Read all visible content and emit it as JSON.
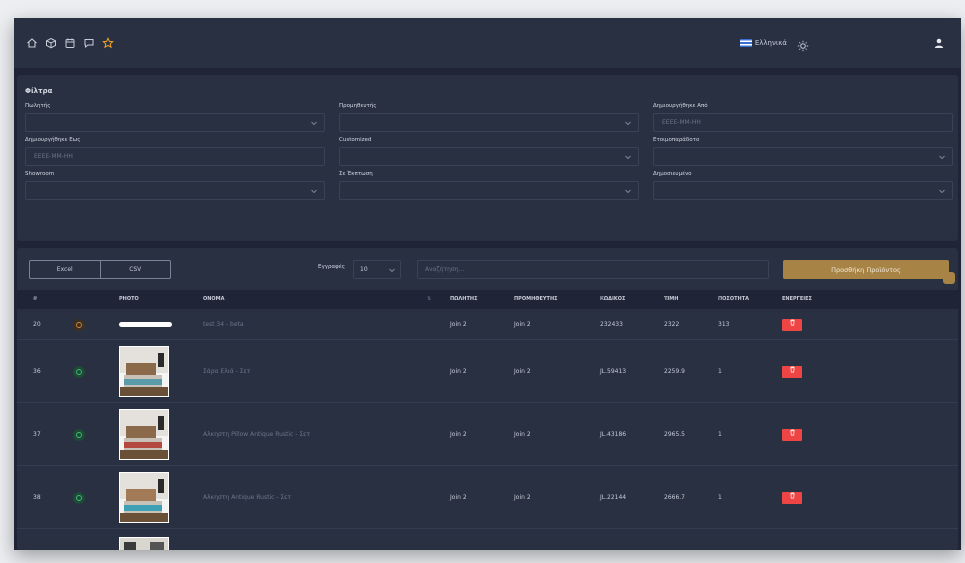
{
  "header": {
    "language": "Ελληνικά"
  },
  "filters": {
    "title": "Φίλτρα",
    "fields": [
      {
        "label": "Πωλητής",
        "value": "",
        "type": "select"
      },
      {
        "label": "Προμηθευτής",
        "value": "",
        "type": "select"
      },
      {
        "label": "Δημιουργήθηκε Από",
        "value": "",
        "placeholder": "ΕΕΕΕ-ΜΜ-ΗΗ",
        "type": "date"
      },
      {
        "label": "Δημιουργήθηκε Εως",
        "value": "",
        "placeholder": "ΕΕΕΕ-ΜΜ-ΗΗ",
        "type": "date"
      },
      {
        "label": "Customized",
        "value": "",
        "type": "select"
      },
      {
        "label": "Ετοιμοπαράδοτο",
        "value": "",
        "type": "select"
      },
      {
        "label": "Showroom",
        "value": "",
        "type": "select"
      },
      {
        "label": "Σε Έκπτωση",
        "value": "",
        "type": "select"
      },
      {
        "label": "Δημοσιευμένο",
        "value": "",
        "type": "select"
      }
    ]
  },
  "toolbar": {
    "excel_label": "Excel",
    "csv_label": "CSV",
    "records_label": "Εγγραφές",
    "records_value": "10",
    "search_placeholder": "Αναζήτηση...",
    "add_label": "Προσθήκη Προϊόντος"
  },
  "table": {
    "headers": {
      "id": "#",
      "photo": "PHOTO",
      "name": "ΟΝΟΜΑ",
      "seller": "ΠΩΛΗΤΗΣ",
      "supplier": "ΠΡΟΜΗΘΕΥΤΗΣ",
      "code": "ΚΩΔΙΚΟΣ",
      "price": "ΤΙΜΗ",
      "quantity": "ΠΟΣΟΤΗΤΑ",
      "actions": "ΕΝΕΡΓΕΙΕΣ"
    },
    "rows": [
      {
        "id": "20",
        "status": "pending",
        "photo": "bar",
        "name": "test 34 - beta",
        "seller": "Join 2",
        "supplier": "Join 2",
        "code": "232433",
        "price": "2322",
        "quantity": "313",
        "actions": 4
      },
      {
        "id": "36",
        "status": "active",
        "photo": "bed",
        "name": "Σάρα Ελιά - Σετ",
        "seller": "Join 2",
        "supplier": "Join 2",
        "code": "JL.59413",
        "price": "2259.9",
        "quantity": "1",
        "actions": 6
      },
      {
        "id": "37",
        "status": "active",
        "photo": "bed-alt",
        "name": "Αλκηστη Pillow Antique Rustic - Σετ",
        "seller": "Join 2",
        "supplier": "Join 2",
        "code": "JL.43186",
        "price": "2965.5",
        "quantity": "1",
        "actions": 6
      },
      {
        "id": "38",
        "status": "active",
        "photo": "bed-alt2",
        "name": "Αλκηστη Antique Rustic - Σετ",
        "seller": "Join 2",
        "supplier": "Join 2",
        "code": "JL.22144",
        "price": "2666.7",
        "quantity": "1",
        "actions": 6
      }
    ]
  },
  "colors": {
    "accent": "#a88346",
    "panel": "#283042",
    "background": "#1f2536",
    "action_edit": "#a88346",
    "action_copy": "#6b7280",
    "action_view": "#1cc3d8",
    "action_warn": "#f5a623",
    "action_alert": "#ef5350",
    "action_delete": "#ef4444"
  }
}
